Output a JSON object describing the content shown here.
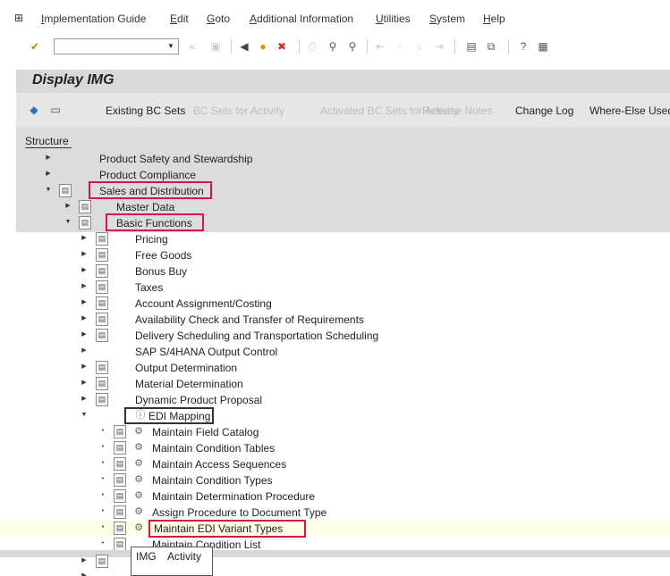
{
  "menu": {
    "app_icon": "sap-window-icon",
    "items": [
      "Implementation Guide",
      "Edit",
      "Goto",
      "Additional Information",
      "Utilities",
      "System",
      "Help"
    ]
  },
  "toolbar": {
    "command_field_value": "",
    "icons": [
      "save-icon",
      "back-icon",
      "exit-icon",
      "cancel-icon",
      "print-icon",
      "find-icon",
      "find-next-icon",
      "first-page-icon",
      "previous-page-icon",
      "next-page-icon",
      "last-page-icon",
      "new-session-icon",
      "shortcut-icon",
      "help-icon",
      "layout-icon"
    ]
  },
  "title": "Display IMG",
  "app_toolbar": {
    "buttons": [
      {
        "label": "Existing BC Sets",
        "enabled": true
      },
      {
        "label": "BC Sets for Activity",
        "enabled": false
      },
      {
        "label": "Activated BC Sets for Activity",
        "enabled": false
      },
      {
        "label": "Release Notes",
        "enabled": false
      },
      {
        "label": "Change Log",
        "enabled": true
      },
      {
        "label": "Where-Else Used",
        "enabled": true
      }
    ]
  },
  "structure_tab": "Structure",
  "tree": [
    "Product Safety and Stewardship",
    "Product Compliance",
    "Sales and Distribution",
    "Master Data",
    "Basic Functions",
    "Pricing",
    "Free Goods",
    "Bonus Buy",
    "Taxes",
    "Account Assignment/Costing",
    "Availability Check and Transfer of Requirements",
    "Delivery Scheduling and Transportation Scheduling",
    "SAP S/4HANA Output Control",
    "Output Determination",
    "Material Determination",
    "Dynamic Product Proposal",
    "EDI Mapping",
    "Maintain Field Catalog",
    "Maintain Condition Tables",
    "Maintain Access Sequences",
    "Maintain Condition Types",
    "Maintain Determination Procedure",
    "Assign Procedure to Document Type",
    "Maintain EDI Variant Types",
    "Maintain Condition List"
  ],
  "tooltip": {
    "img": "IMG",
    "activity": "Activity"
  },
  "colors": {
    "highlight_box": "#d8124a",
    "title_bg": "#d9d9d9",
    "selected_row_bg": "#fffde6"
  }
}
